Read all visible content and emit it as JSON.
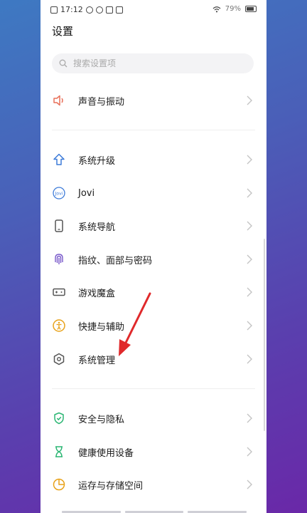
{
  "status": {
    "time": "17:12",
    "battery": "79%"
  },
  "header": {
    "title": "设置"
  },
  "search": {
    "placeholder": "搜索设置项"
  },
  "items": [
    {
      "label": "声音与振动",
      "icon": "speaker-icon",
      "color": "#e8705a"
    },
    {
      "label": "系统升级",
      "icon": "arrow-up-icon",
      "color": "#3d7bd9"
    },
    {
      "label": "Jovi",
      "icon": "jovi-icon",
      "color": "#3d7bd9"
    },
    {
      "label": "系统导航",
      "icon": "phone-icon",
      "color": "#555555"
    },
    {
      "label": "指纹、面部与密码",
      "icon": "fingerprint-icon",
      "color": "#7a5acb"
    },
    {
      "label": "游戏魔盒",
      "icon": "gamepad-icon",
      "color": "#555555"
    },
    {
      "label": "快捷与辅助",
      "icon": "accessibility-icon",
      "color": "#e8a21a"
    },
    {
      "label": "系统管理",
      "icon": "hexagon-gear-icon",
      "color": "#555555"
    },
    {
      "label": "安全与隐私",
      "icon": "shield-icon",
      "color": "#2bb673"
    },
    {
      "label": "健康使用设备",
      "icon": "hourglass-icon",
      "color": "#2bb673"
    },
    {
      "label": "运存与存储空间",
      "icon": "pie-chart-icon",
      "color": "#e8a21a"
    }
  ],
  "annotation": {
    "color": "#e0292b"
  }
}
